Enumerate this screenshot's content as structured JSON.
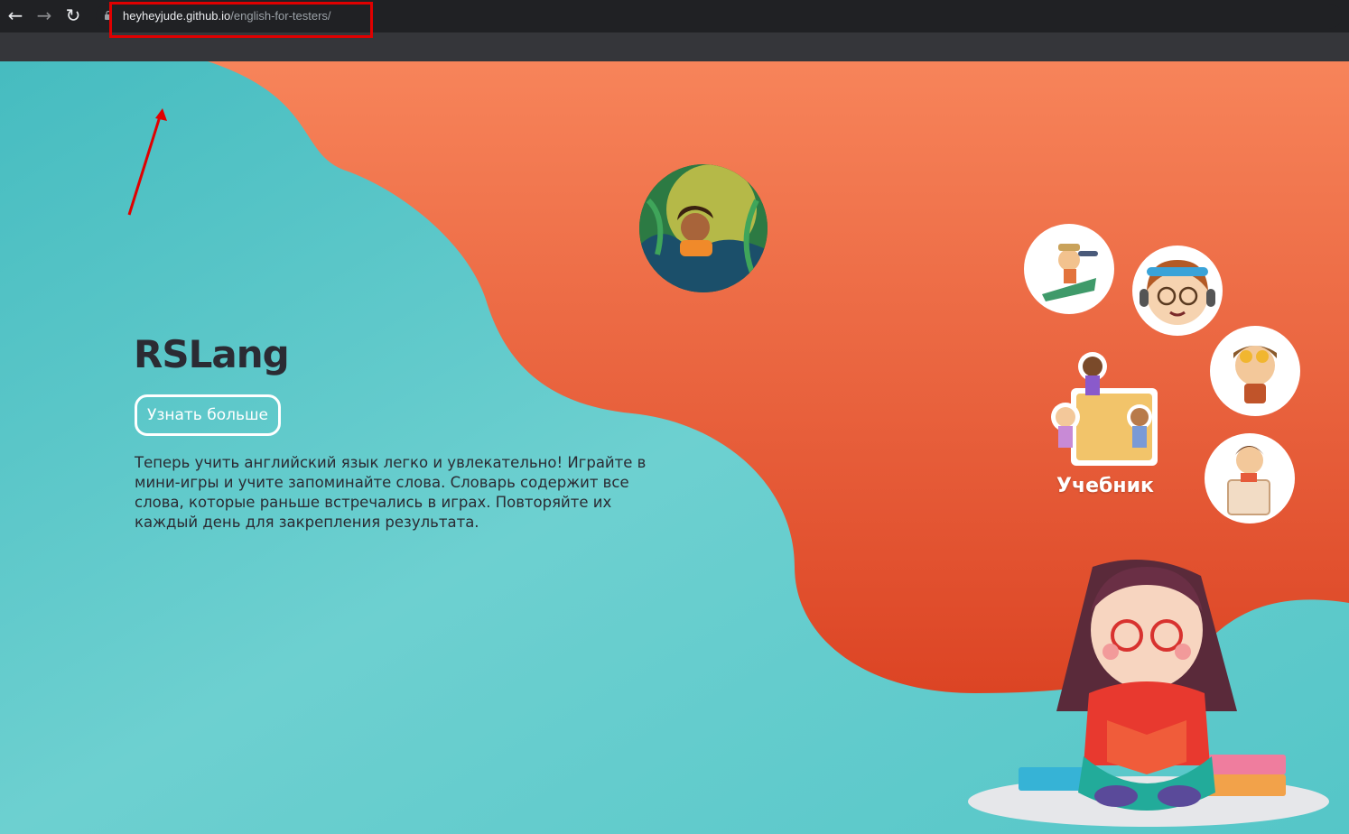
{
  "browser": {
    "url_host": "heyheyjude.github.io",
    "url_path": "/english-for-testers/"
  },
  "hero": {
    "title": "RSLang",
    "learn_more_label": "Узнать больше",
    "description": "Теперь учить английский язык легко и увлекательно! Играйте в мини-игры и учите запоминайте слова. Словарь содержит все слова, которые раньше встречались в играх. Повторяйте их каждый день для закрепления результата."
  },
  "nav": {
    "textbook_label": "Учебник"
  },
  "colors": {
    "teal": "#5cc9c9",
    "orange_top": "#f7845a",
    "orange_bottom": "#dc4424",
    "highlight_red": "#e00000",
    "text_dark": "#2b2b33"
  },
  "icons": [
    "back-arrow-icon",
    "forward-arrow-icon",
    "reload-icon",
    "lock-icon"
  ]
}
